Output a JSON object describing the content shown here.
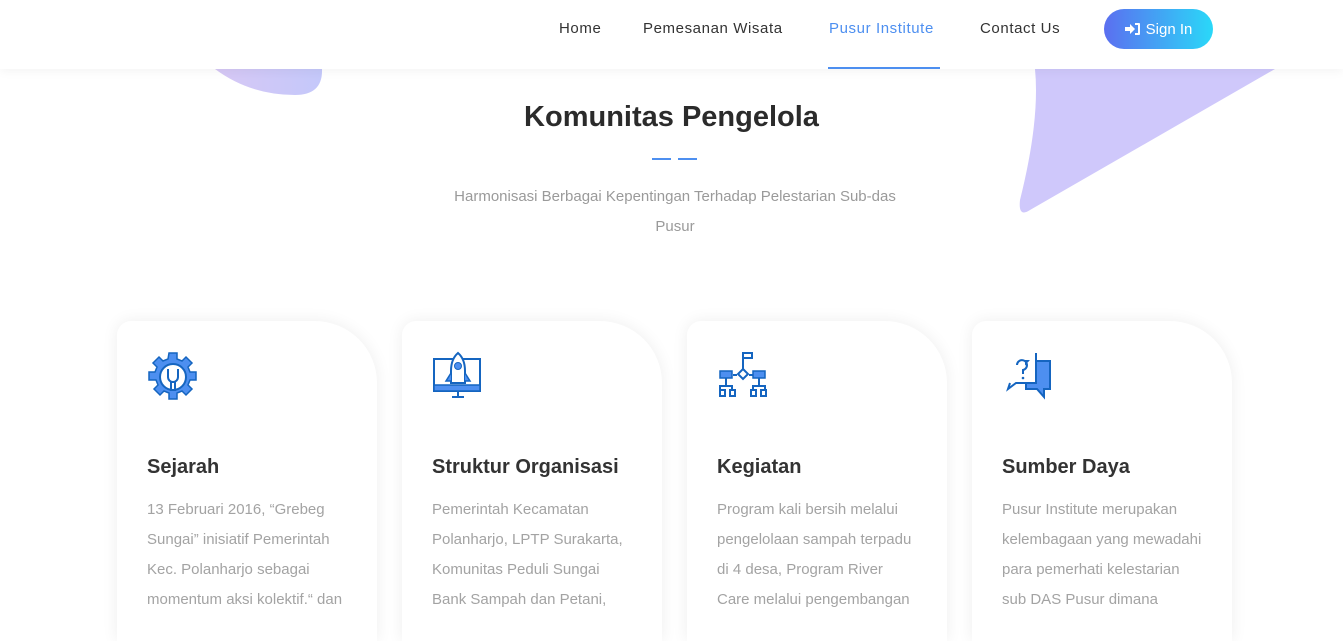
{
  "nav": {
    "items": [
      {
        "label": "Home"
      },
      {
        "label": "Pemesanan Wisata"
      },
      {
        "label": "Pusur Institute",
        "active": true
      },
      {
        "label": "Contact Us"
      }
    ],
    "signin": "Sign In",
    "signin_icon": "sign-in-icon"
  },
  "section": {
    "title": "Komunitas Pengelola",
    "subtitle": "Harmonisasi Berbagai Kepentingan Terhadap Pelestarian Sub-das Pusur"
  },
  "cards": [
    {
      "icon": "gear-wrench-icon",
      "title": "Sejarah",
      "text": "13 Februari 2016, “Grebeg Sungai” inisiatif Pemerintah Kec. Polanharjo sebagai momentum aksi kolektif.“ dan"
    },
    {
      "icon": "rocket-monitor-icon",
      "title": "Struktur Organisasi",
      "text": "Pemerintah Kecamatan Polanharjo, LPTP Surakarta, Komunitas Peduli Sungai Bank Sampah dan Petani,"
    },
    {
      "icon": "flowchart-icon",
      "title": "Kegiatan",
      "text": "Program kali bersih melalui pengelolaan sampah terpadu di 4 desa, Program River Care melalui pengembangan"
    },
    {
      "icon": "question-chat-icon",
      "title": "Sumber Daya",
      "text": "Pusur Institute merupakan kelembagaan yang mewadahi para pemerhati kelestarian sub DAS Pusur dimana"
    }
  ],
  "colors": {
    "accent": "#4d8ff0",
    "icon": "#1565c0",
    "blob": "#cfc8fb"
  }
}
